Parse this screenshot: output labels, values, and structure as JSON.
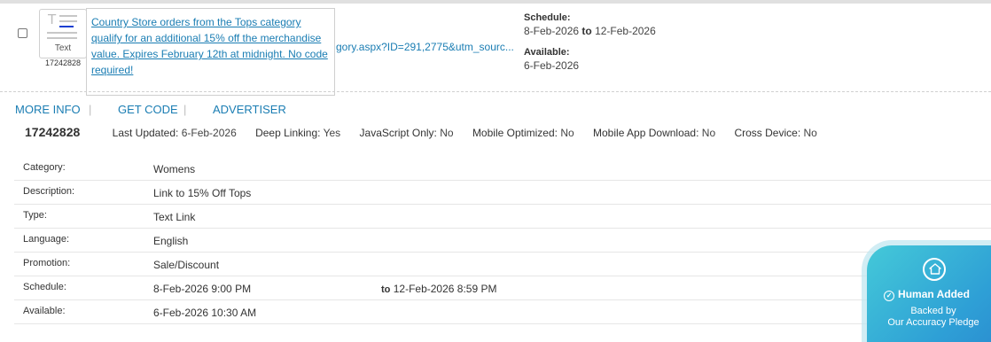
{
  "link": {
    "type_label": "Text",
    "id": "17242828",
    "popup_text": "Country Store orders from the Tops category qualify for an additional 15% off the merchandise value. Expires February 12th at midnight. No code required!",
    "url_fragment": "gory.aspx?ID=291,2775&utm_sourc..."
  },
  "schedule": {
    "label": "Schedule:",
    "start": "8-Feb-2026",
    "to": "to",
    "end": "12-Feb-2026",
    "available_label": "Available:",
    "available": "6-Feb-2026"
  },
  "actions": {
    "more_info": "MORE INFO",
    "get_code": "GET CODE",
    "advertiser": "ADVERTISER",
    "sep": "|"
  },
  "meta": {
    "id": "17242828",
    "last_updated_label": "Last Updated:",
    "last_updated": "6-Feb-2026",
    "deep_linking_label": "Deep Linking:",
    "deep_linking": "Yes",
    "js_only_label": "JavaScript Only:",
    "js_only": "No",
    "mobile_opt_label": "Mobile Optimized:",
    "mobile_opt": "No",
    "mobile_app_label": "Mobile App Download:",
    "mobile_app": "No",
    "cross_device_label": "Cross Device:",
    "cross_device": "No"
  },
  "details": [
    {
      "key": "Category:",
      "value": "Womens"
    },
    {
      "key": "Description:",
      "value": "Link to 15% Off Tops"
    },
    {
      "key": "Type:",
      "value": "Text Link"
    },
    {
      "key": "Language:",
      "value": "English"
    },
    {
      "key": "Promotion:",
      "value": "Sale/Discount"
    },
    {
      "key": "Schedule:",
      "value": "8-Feb-2026 9:00 PM",
      "to": "to",
      "end": "12-Feb-2026 8:59 PM"
    },
    {
      "key": "Available:",
      "value": "6-Feb-2026 10:30 AM"
    }
  ],
  "pledge": {
    "title": "Human Added",
    "line1": "Backed by",
    "line2": "Our Accuracy Pledge",
    "icon": "house-circle-icon"
  },
  "colors": {
    "link_blue": "#1a7db3",
    "pledge_gradient_start": "#44c9d8",
    "pledge_gradient_end": "#2b8ed0"
  }
}
